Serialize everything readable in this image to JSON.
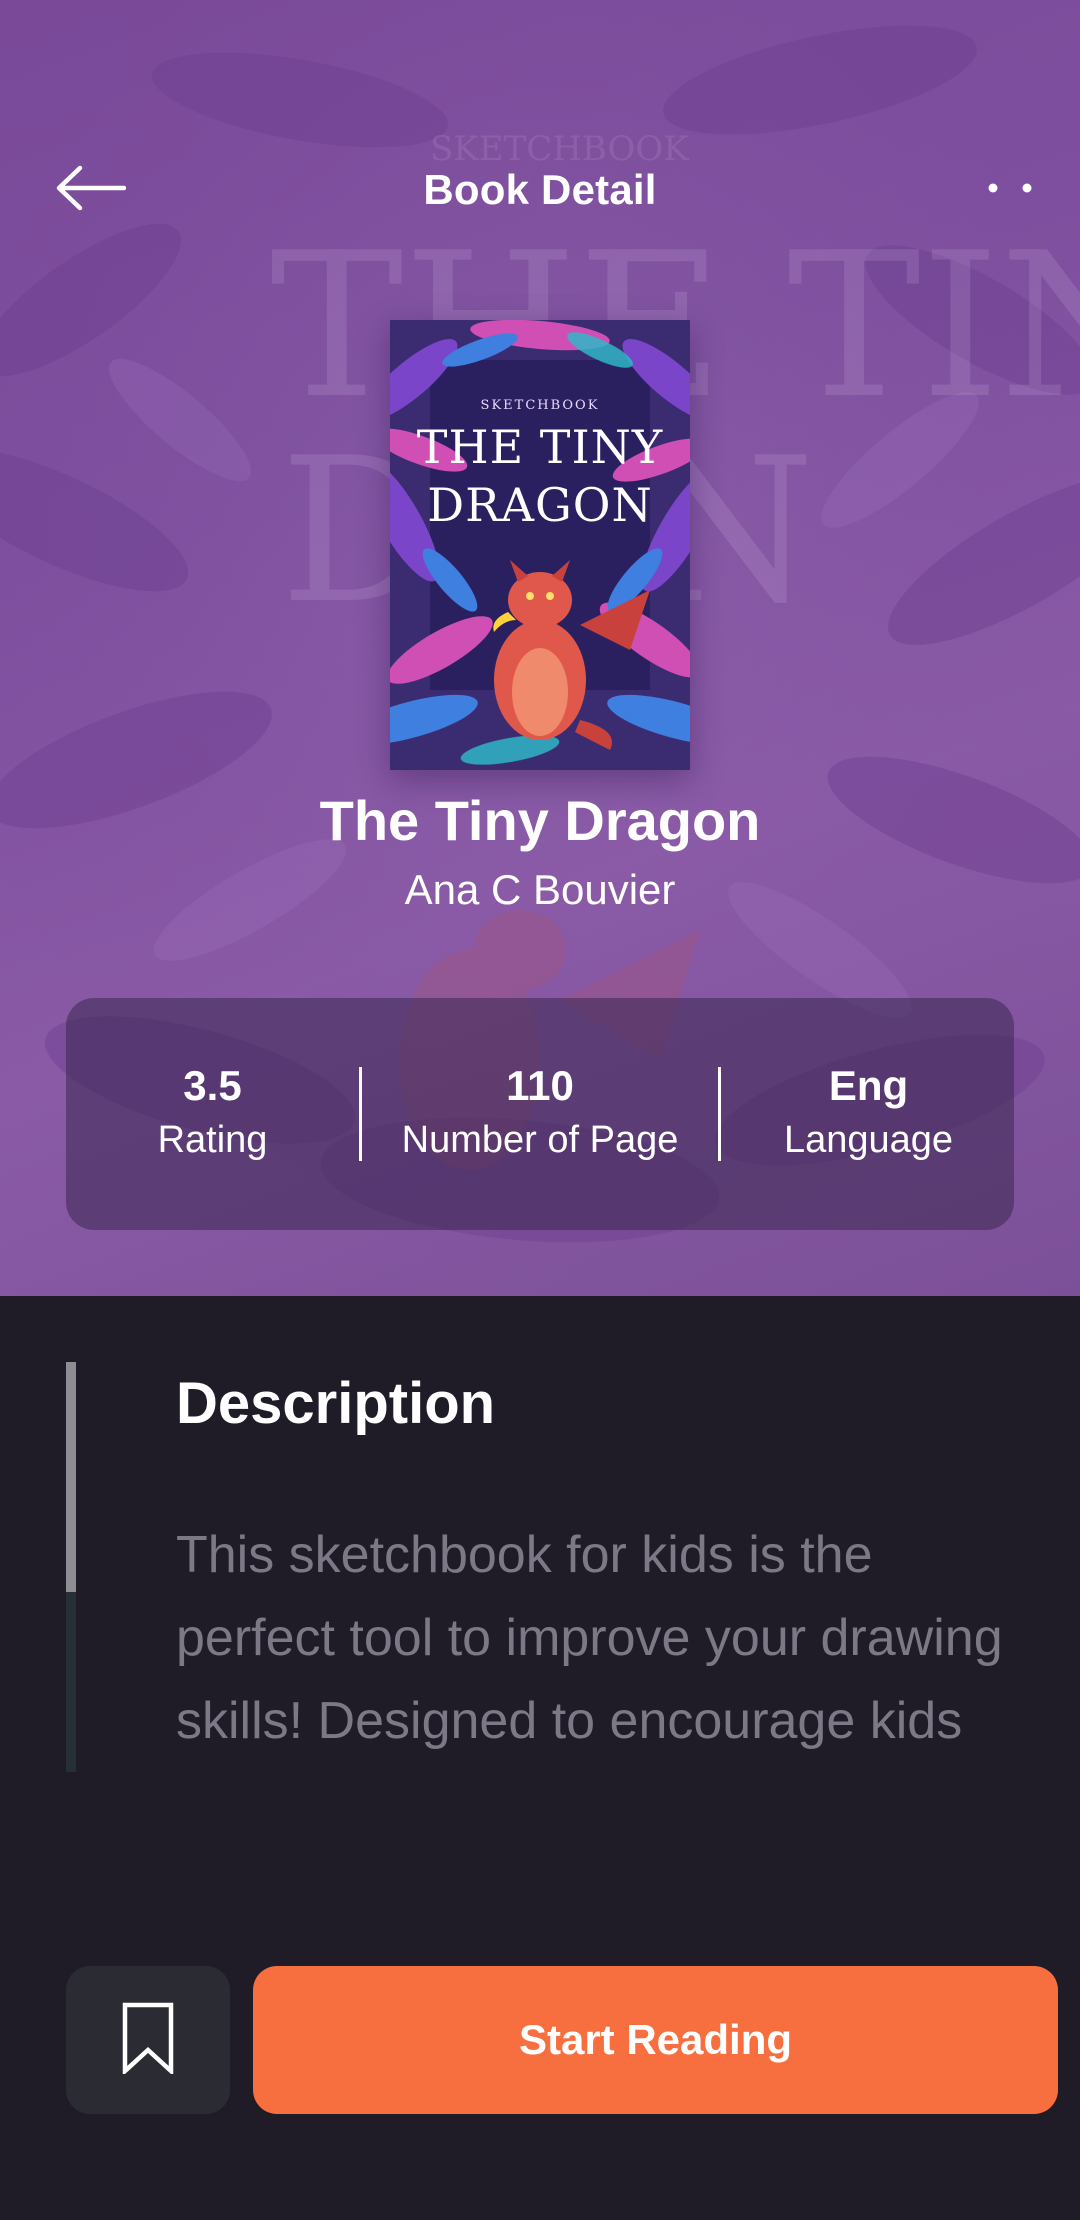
{
  "header": {
    "title": "Book Detail",
    "back_icon": "arrow-left-icon",
    "more_icon": "more-dots-icon"
  },
  "book": {
    "cover": {
      "series": "SKETCHBOOK",
      "title_line1": "The Tiny",
      "title_line2": "Dragon"
    },
    "title": "The Tiny Dragon",
    "author": "Ana C Bouvier"
  },
  "stats": [
    {
      "value": "3.5",
      "label": "Rating"
    },
    {
      "value": "110",
      "label": "Number of Page"
    },
    {
      "value": "Eng",
      "label": "Language"
    }
  ],
  "description": {
    "heading": "Description",
    "text": "This sketchbook for kids is the perfect tool to improve your drawing skills! Designed to encourage kids around the world to express their unique person..."
  },
  "actions": {
    "bookmark_icon": "bookmark-icon",
    "start_label": "Start Reading"
  },
  "colors": {
    "hero_bg": "#7d4f9e",
    "screen_bg": "#1f1c28",
    "accent": "#f86f3f",
    "description_text": "#7c7886"
  }
}
